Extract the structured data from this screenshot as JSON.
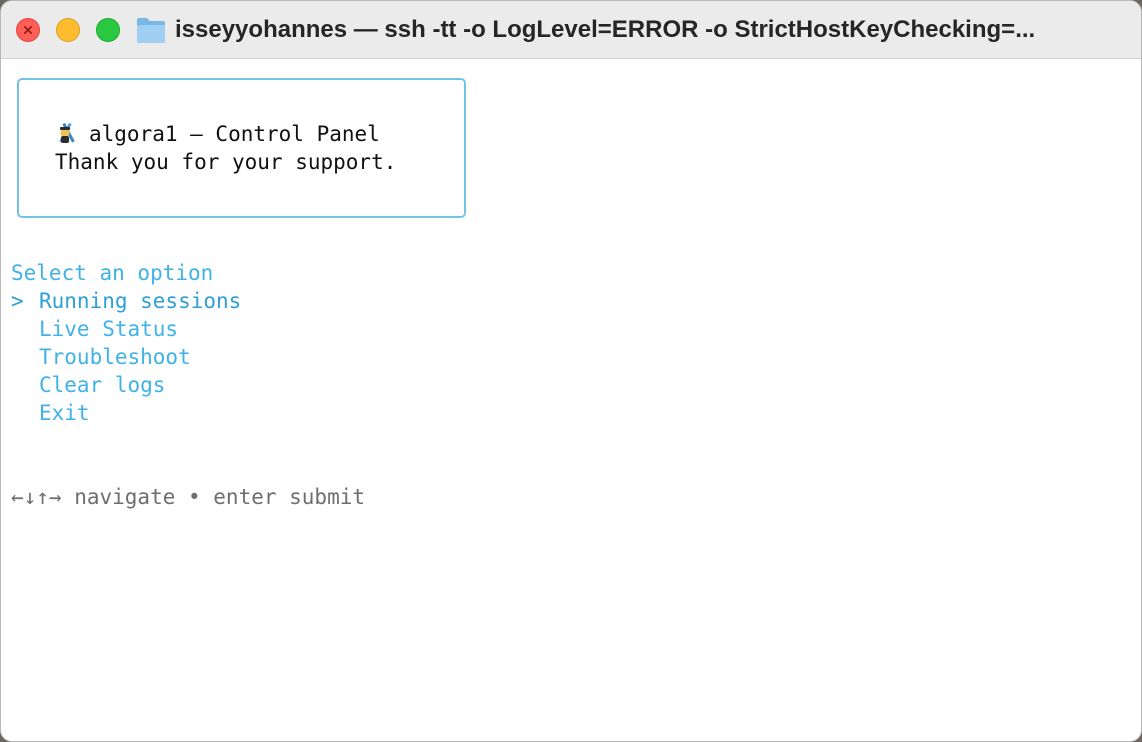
{
  "window": {
    "title": "isseyyohannes — ssh -tt -o LogLevel=ERROR -o StrictHostKeyChecking=...",
    "icon": "folder-icon"
  },
  "panel": {
    "heading": "algora1 — Control Panel",
    "subheading": "Thank you for your support.",
    "mascot_icon": "mascot-icon",
    "border_color": "#73c3e6"
  },
  "menu": {
    "prompt": "Select an option",
    "cursor": ">",
    "selected_index": 0,
    "items": [
      {
        "label": "Running sessions"
      },
      {
        "label": "Live Status"
      },
      {
        "label": "Troubleshoot"
      },
      {
        "label": "Clear logs"
      },
      {
        "label": "Exit"
      }
    ],
    "color": "#3fb2e8"
  },
  "help": {
    "text": "←↓↑→ navigate • enter submit"
  }
}
